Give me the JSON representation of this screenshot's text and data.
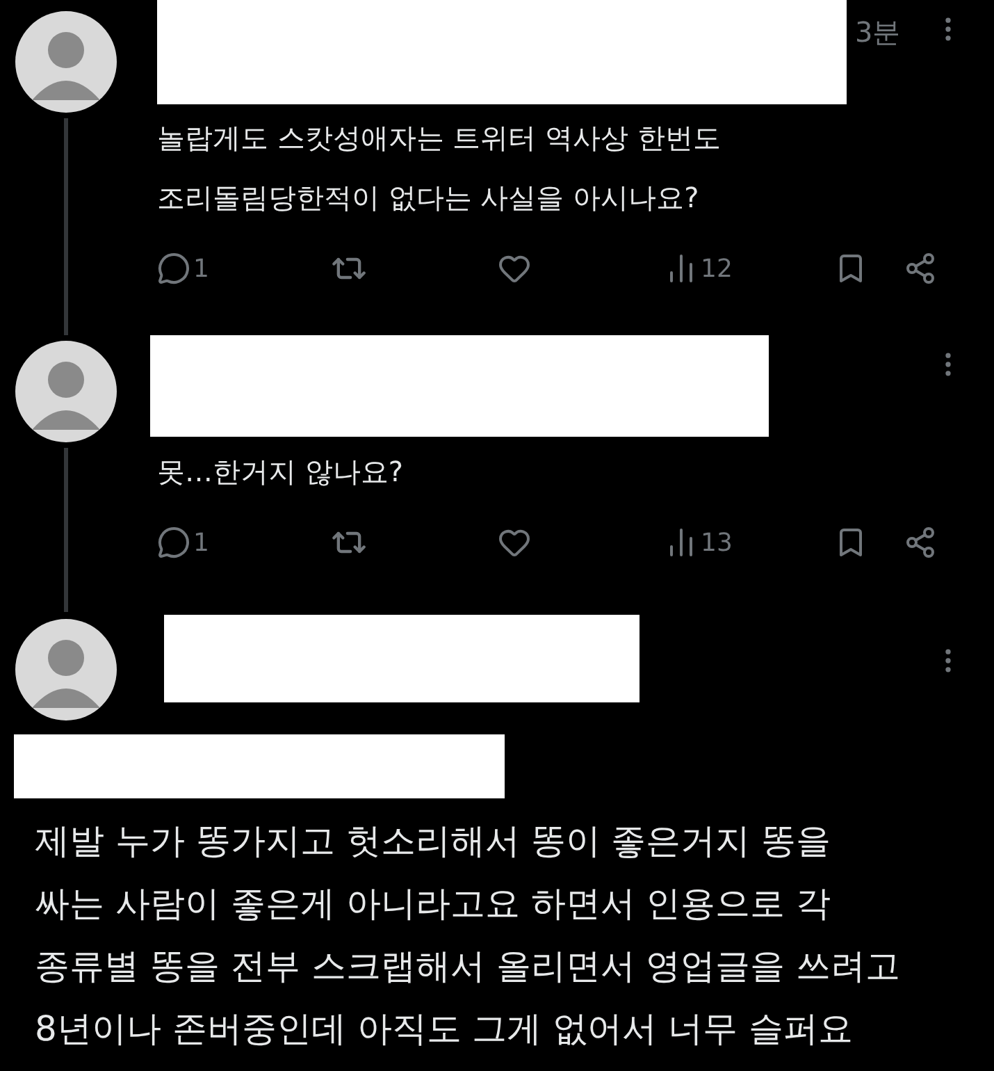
{
  "posts": [
    {
      "kind": "reply",
      "time": "3분",
      "thread_line": true,
      "text_lines": [
        "놀랍게도 스캇성애자는 트위터 역사상 한번도",
        "조리돌림당한적이 없다는 사실을 아시나요?"
      ],
      "replies": "1",
      "views": "12"
    },
    {
      "kind": "reply",
      "thread_line": true,
      "text_lines": [
        "못…한거지 않나요?"
      ],
      "replies": "1",
      "views": "13"
    },
    {
      "kind": "focused",
      "thread_line": false,
      "text_lines": [
        "제발 누가 똥가지고 헛소리해서 똥이 좋은거지 똥을",
        "싸는 사람이 좋은게 아니라고요 하면서 인용으로 각",
        "종류별 똥을 전부 스크랩해서 올리면서 영업글을 쓰려고",
        "8년이나 존버중인데 아직도 그게 없어서 너무 슬퍼요"
      ]
    }
  ]
}
